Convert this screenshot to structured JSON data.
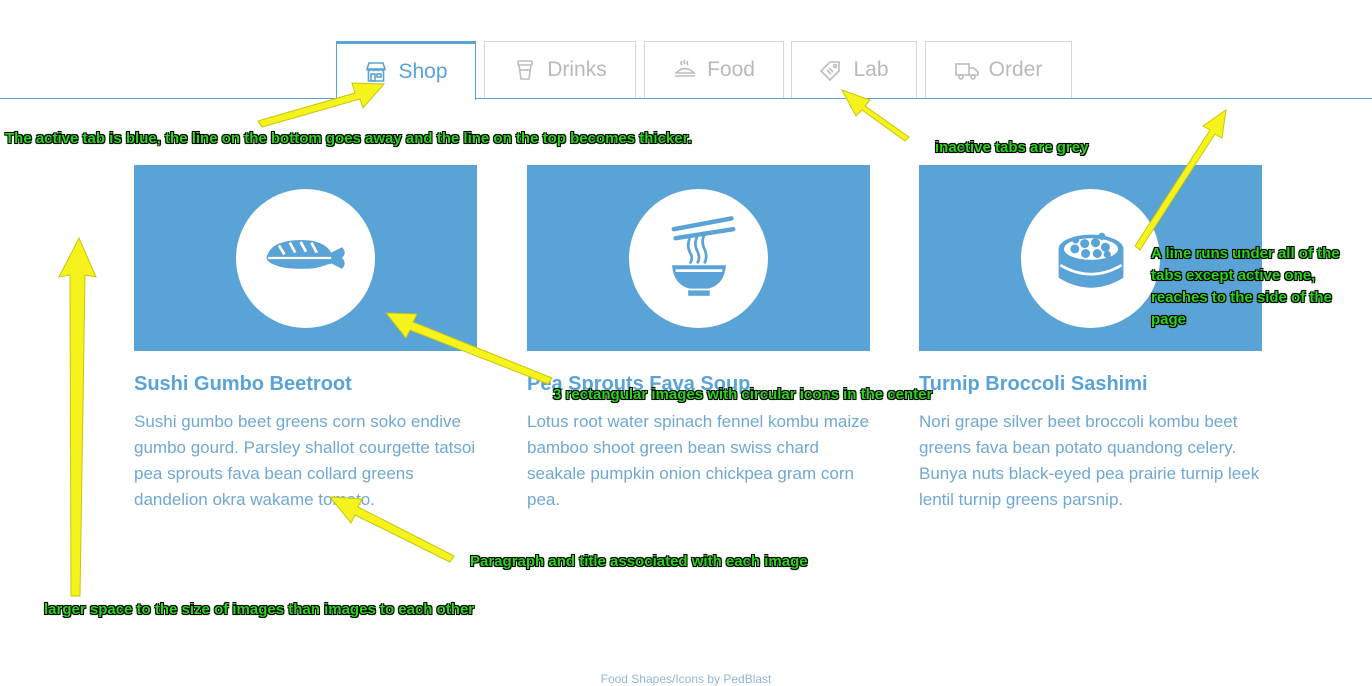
{
  "tabs": [
    {
      "label": "Shop",
      "icon": "shop-icon",
      "active": true
    },
    {
      "label": "Drinks",
      "icon": "drink-cup-icon",
      "active": false
    },
    {
      "label": "Food",
      "icon": "food-dish-icon",
      "active": false
    },
    {
      "label": "Lab",
      "icon": "lab-tag-icon",
      "active": false
    },
    {
      "label": "Order",
      "icon": "delivery-truck-icon",
      "active": false
    }
  ],
  "cards": [
    {
      "icon": "sushi-nigiri-icon",
      "title": "Sushi Gumbo Beetroot",
      "text": "Sushi gumbo beet greens corn soko endive gumbo gourd. Parsley shallot courgette tatsoi pea sprouts fava bean collard greens dandelion okra wakame tomato."
    },
    {
      "icon": "noodle-bowl-icon",
      "title": "Pea Sprouts Fava Soup",
      "text": "Lotus root water spinach fennel kombu maize bamboo shoot green bean swiss chard seakale pumpkin onion chickpea gram corn pea."
    },
    {
      "icon": "sushi-roll-icon",
      "title": "Turnip Broccoli Sashimi",
      "text": "Nori grape silver beet broccoli kombu beet greens fava bean potato quandong celery. Bunya nuts black-eyed pea prairie turnip leek lentil turnip greens parsnip."
    }
  ],
  "annotations": {
    "active_tab": "The active tab is blue, the line on the bottom goes away and the line on the top becomes thicker.",
    "inactive_tabs": "inactive tabs are grey",
    "line_under_tabs": "A line runs under all of the tabs except active one, reaches to the side of the page",
    "images": "3 rectangular images with circular icons in the center",
    "paragraph": "Paragraph and title associated with each image",
    "spacing": "larger space to the size of images than images to each other"
  },
  "footer": "Food Shapes/Icons by PedBlast",
  "colors": {
    "accent": "#5aa3d6",
    "inactive": "#b9b9b9",
    "annotation_text": "#2ad619",
    "arrow": "#f6f31c"
  }
}
